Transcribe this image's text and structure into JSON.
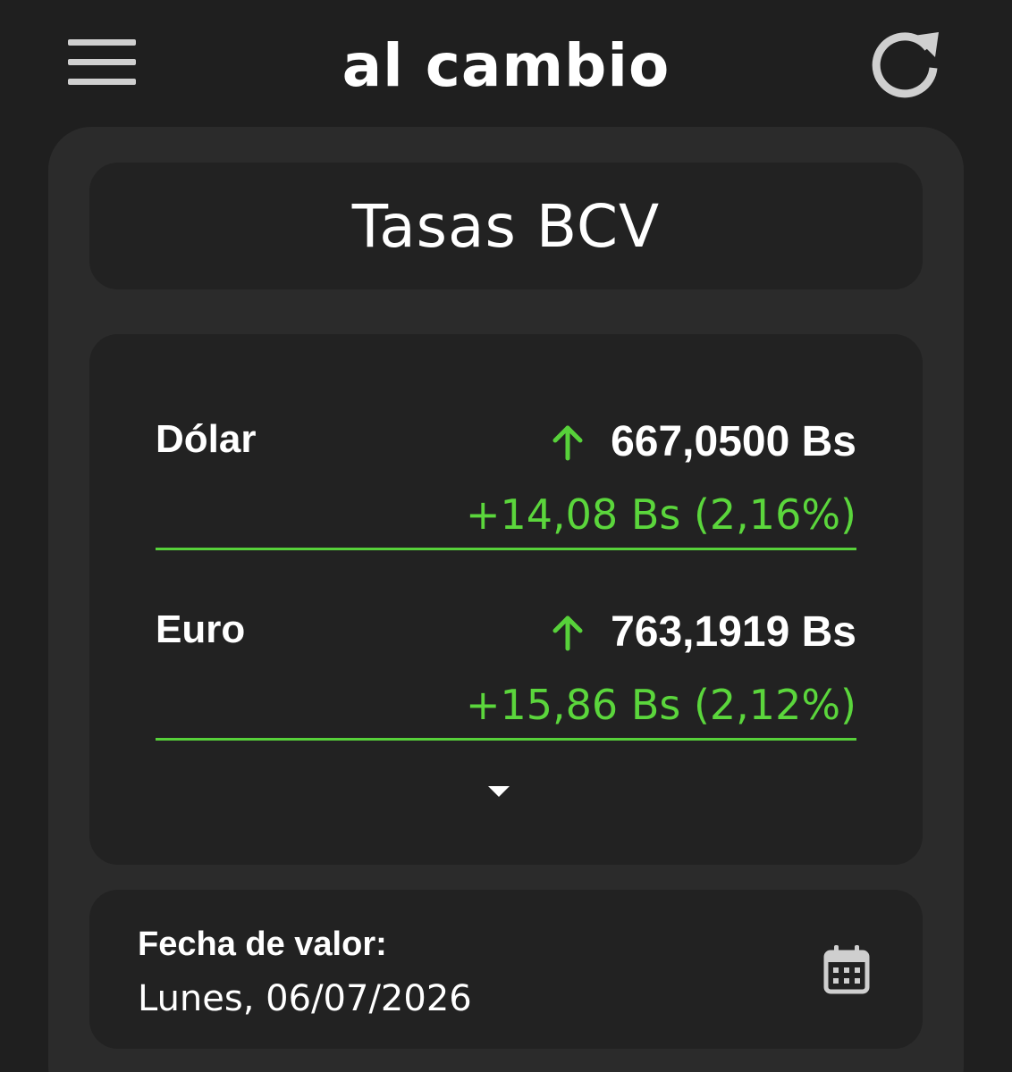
{
  "app": {
    "brand": "al cambio",
    "menu_icon": "hamburger-menu-icon",
    "refresh_icon": "refresh-icon"
  },
  "title": "Tasas BCV",
  "rates": [
    {
      "name": "Dólar",
      "trend_icon": "arrow-up-icon",
      "value": "667,0500 Bs",
      "change": "+14,08 Bs (2,16%)"
    },
    {
      "name": "Euro",
      "trend_icon": "arrow-up-icon",
      "value": "763,1919 Bs",
      "change": "+15,86 Bs (2,12%)"
    }
  ],
  "expand_icon": "caret-down-icon",
  "date": {
    "label": "Fecha de valor:",
    "value": "Lunes, 06/07/2026",
    "icon": "calendar-icon"
  },
  "colors": {
    "background": "#1f1f1f",
    "panel": "#2b2b2b",
    "card": "#222222",
    "accent_green": "#57d13a",
    "text": "#ffffff",
    "icon_gray": "#cfcfcf"
  }
}
